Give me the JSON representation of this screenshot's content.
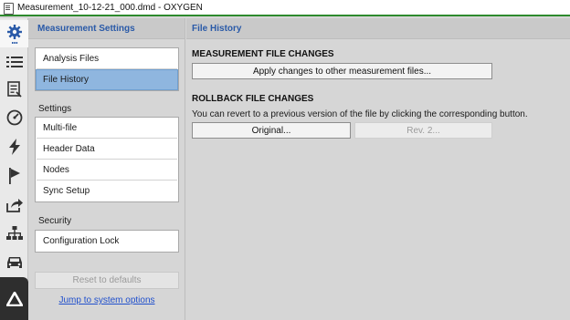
{
  "window": {
    "title": "Measurement_10-12-21_000.dmd - OXYGEN"
  },
  "iconbar": {
    "items": [
      {
        "icon": "settings-gear-icon",
        "active": true
      },
      {
        "icon": "list-icon"
      },
      {
        "icon": "report-icon"
      },
      {
        "icon": "gauge-icon"
      },
      {
        "icon": "lightning-icon"
      },
      {
        "icon": "flag-icon"
      },
      {
        "icon": "export-icon"
      },
      {
        "icon": "network-icon"
      },
      {
        "icon": "car-icon"
      },
      {
        "icon": "oxygen-logo-icon"
      }
    ]
  },
  "sidebar": {
    "title": "Measurement Settings",
    "files_group": [
      {
        "label": "Analysis Files",
        "selected": false
      },
      {
        "label": "File History",
        "selected": true
      }
    ],
    "settings_label": "Settings",
    "settings_group": [
      {
        "label": "Multi-file"
      },
      {
        "label": "Header Data"
      },
      {
        "label": "Nodes"
      },
      {
        "label": "Sync Setup"
      }
    ],
    "security_label": "Security",
    "security_group": [
      {
        "label": "Configuration Lock"
      }
    ],
    "reset_label": "Reset to defaults",
    "system_link": "Jump to system options"
  },
  "main": {
    "title": "File History",
    "measurement_section": {
      "title": "MEASUREMENT FILE CHANGES",
      "apply_button": "Apply changes to other measurement files..."
    },
    "rollback_section": {
      "title": "ROLLBACK FILE CHANGES",
      "description": "You can revert to a previous version of the file by clicking the corresponding button.",
      "original_button": "Original...",
      "rev_button": "Rev. 2..."
    }
  },
  "colors": {
    "accent_blue": "#2a5aa8",
    "selected_row": "#8fb6df",
    "titlebar_green": "#2d8a2d",
    "link": "#1f4fcc"
  }
}
